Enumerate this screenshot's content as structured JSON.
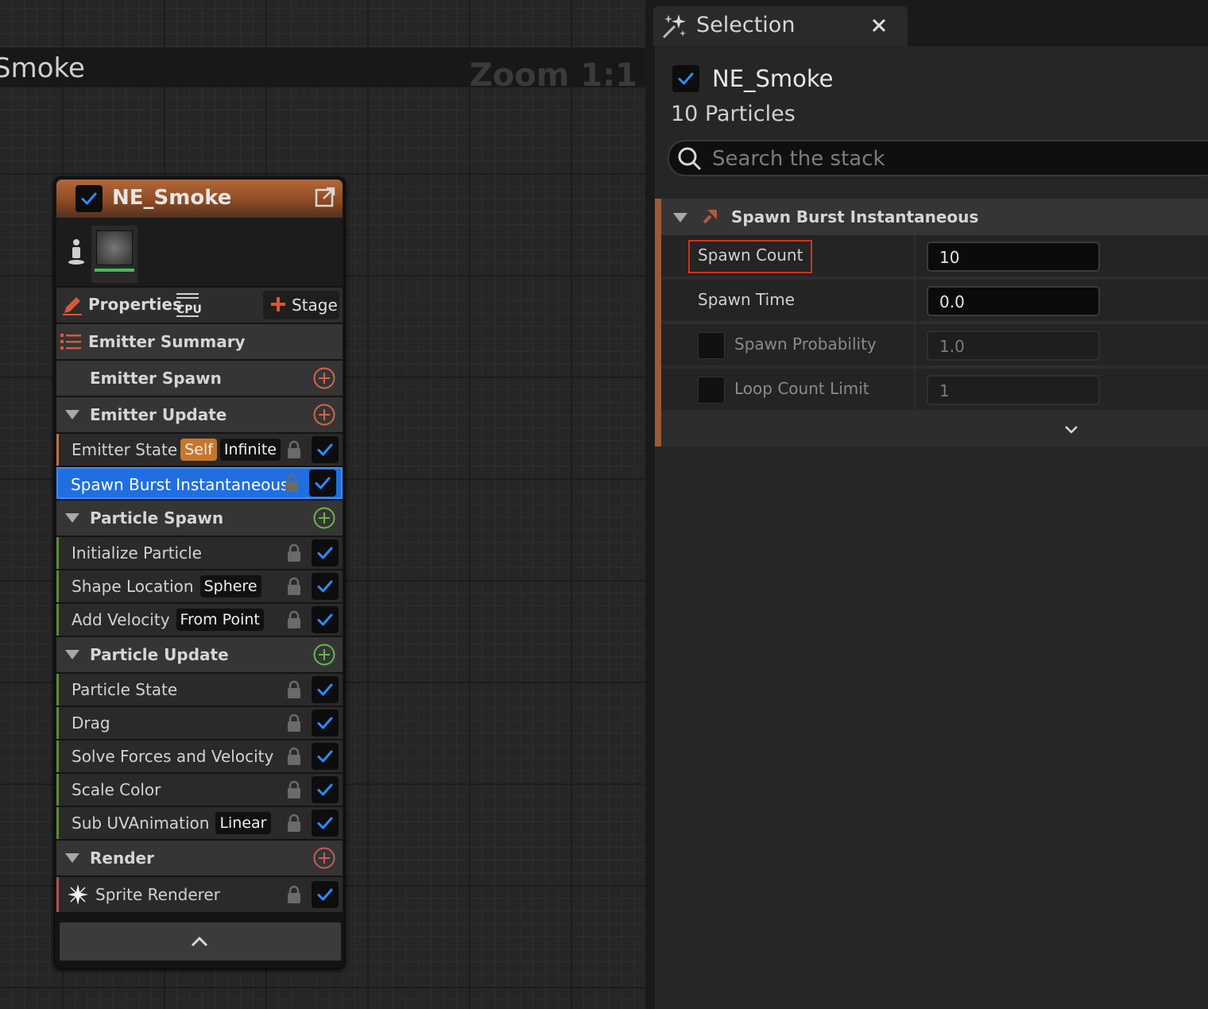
{
  "graph": {
    "title": "Smoke",
    "zoom": "Zoom 1:1"
  },
  "node": {
    "name": "NE_Smoke",
    "properties_label": "Properties",
    "cpu_label": "CPU",
    "stage_label": "Stage",
    "sections": {
      "emitter_summary": "Emitter Summary",
      "emitter_spawn": "Emitter Spawn",
      "emitter_update": "Emitter Update",
      "particle_spawn": "Particle Spawn",
      "particle_update": "Particle Update",
      "render": "Render"
    },
    "modules": {
      "emitter_state": {
        "label": "Emitter State",
        "tag1": "Self",
        "tag2": "Infinite"
      },
      "spawn_burst": {
        "label": "Spawn Burst Instantaneous"
      },
      "initialize_particle": {
        "label": "Initialize Particle"
      },
      "shape_location": {
        "label": "Shape Location",
        "tag": "Sphere"
      },
      "add_velocity": {
        "label": "Add Velocity",
        "tag": "From Point"
      },
      "particle_state": {
        "label": "Particle State"
      },
      "drag": {
        "label": "Drag"
      },
      "solve_forces": {
        "label": "Solve Forces and Velocity"
      },
      "scale_color": {
        "label": "Scale Color"
      },
      "sub_uv": {
        "label": "Sub UVAnimation",
        "tag": "Linear"
      },
      "sprite_renderer": {
        "label": "Sprite Renderer"
      }
    }
  },
  "panel": {
    "tab_title": "Selection",
    "emitter_name": "NE_Smoke",
    "particles": "10 Particles",
    "search_placeholder": "Search the stack",
    "module_title": "Spawn Burst Instantaneous",
    "params": {
      "spawn_count": {
        "label": "Spawn Count",
        "value": "10"
      },
      "spawn_time": {
        "label": "Spawn Time",
        "value": "0.0"
      },
      "spawn_probability": {
        "label": "Spawn Probability",
        "value": "1.0"
      },
      "loop_count_limit": {
        "label": "Loop Count Limit",
        "value": "1"
      }
    }
  },
  "colors": {
    "accent_blue": "#1f6fe0",
    "node_header": "#8e4b24",
    "highlight_red": "#d0331f"
  }
}
